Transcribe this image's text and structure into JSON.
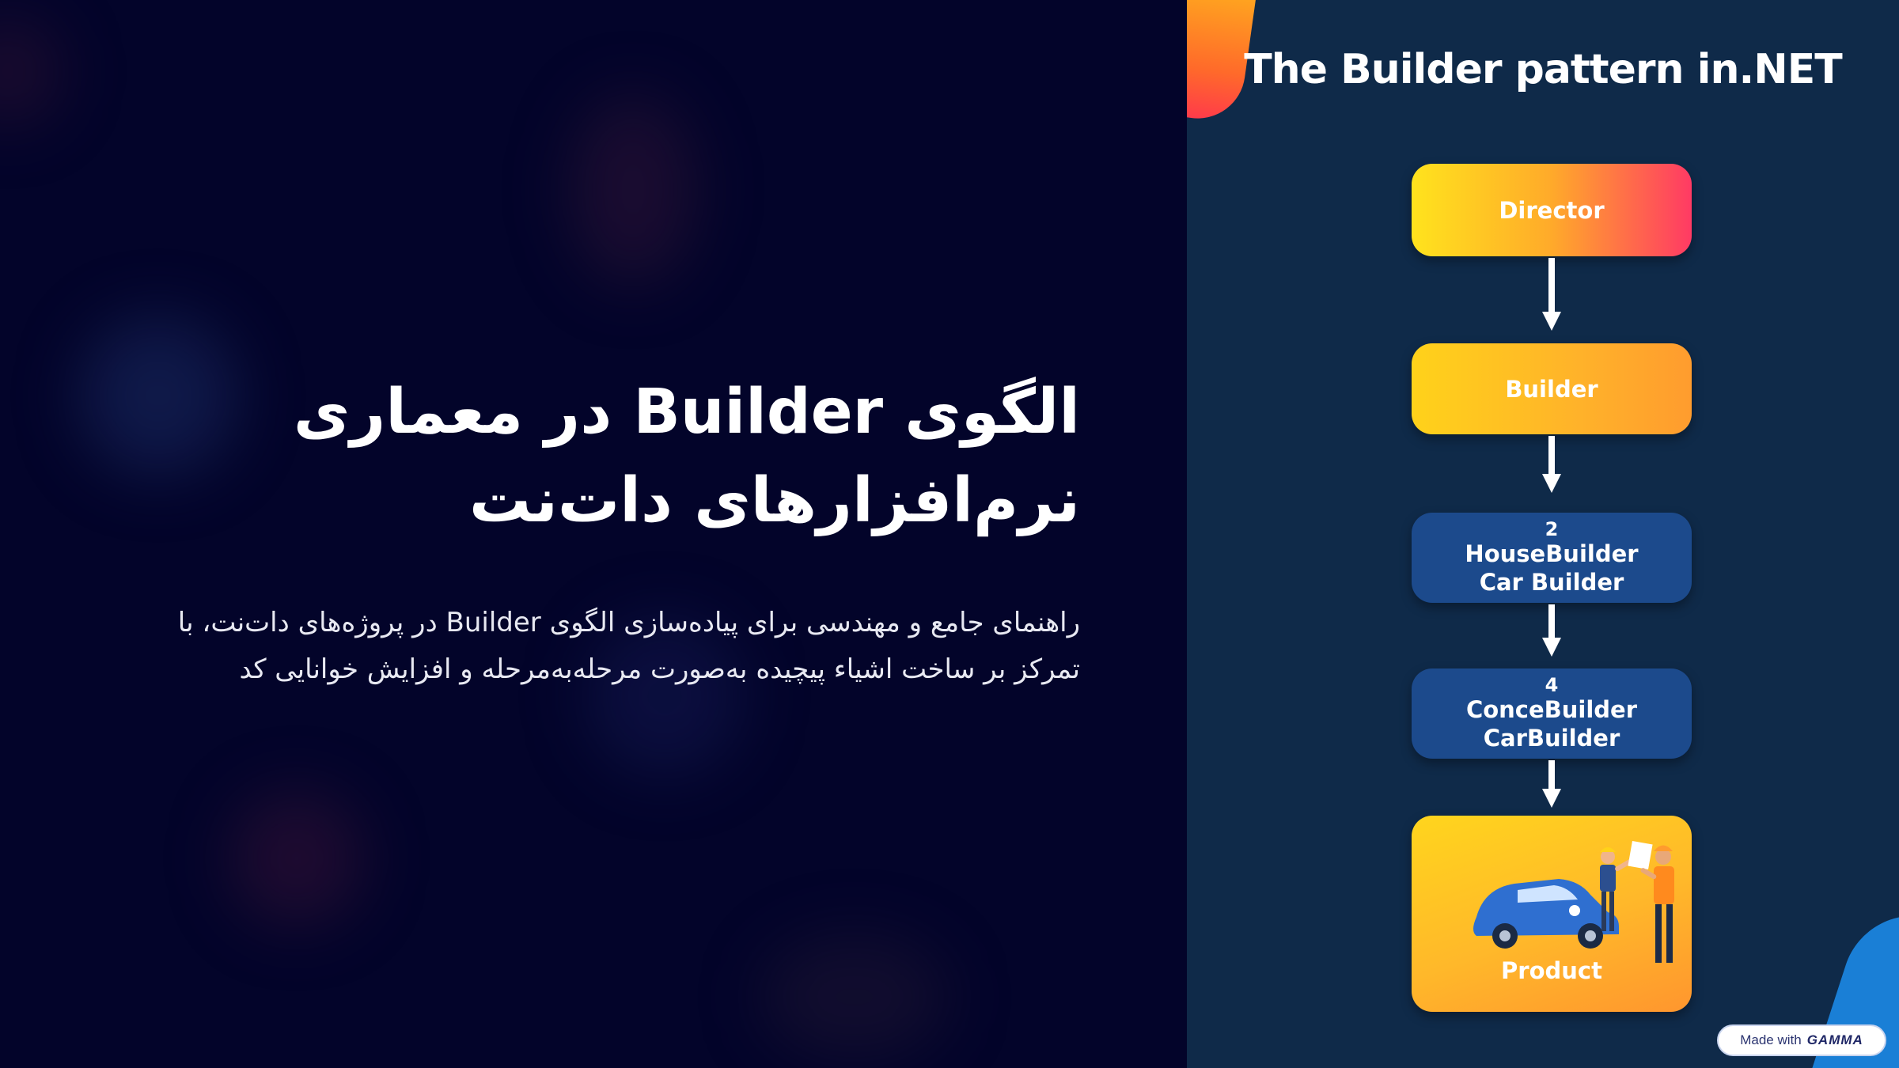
{
  "slide": {
    "title": "الگوی Builder در معماری نرم‌افزارهای دات‌نت",
    "subtitle": "راهنمای جامع و مهندسی برای پیاده‌سازی الگوی Builder در پروژه‌های دات‌نت، با تمرکز بر ساخت اشیاء پیچیده به‌صورت مرحله‌به‌مرحله و افزایش خوانایی کد"
  },
  "diagram": {
    "title": "The Builder pattern in.NET",
    "boxes": {
      "director": "Director",
      "builder": "Builder",
      "house_num": "2",
      "house_line1": "HouseBuilder",
      "house_line2": "Car Builder",
      "concrete_num": "4",
      "concrete_line1": "ConceBuilder",
      "concrete_line2": "CarBuilder",
      "product": "Product"
    }
  },
  "badge": {
    "prefix": "Made with",
    "brand": "GAMMA"
  },
  "colors": {
    "background": "#03042a",
    "diagram_bg": "#0f2a49",
    "blue_box": "#1c4a8c",
    "accent_yellow": "#ffd21a",
    "accent_pink": "#ff3a64"
  }
}
